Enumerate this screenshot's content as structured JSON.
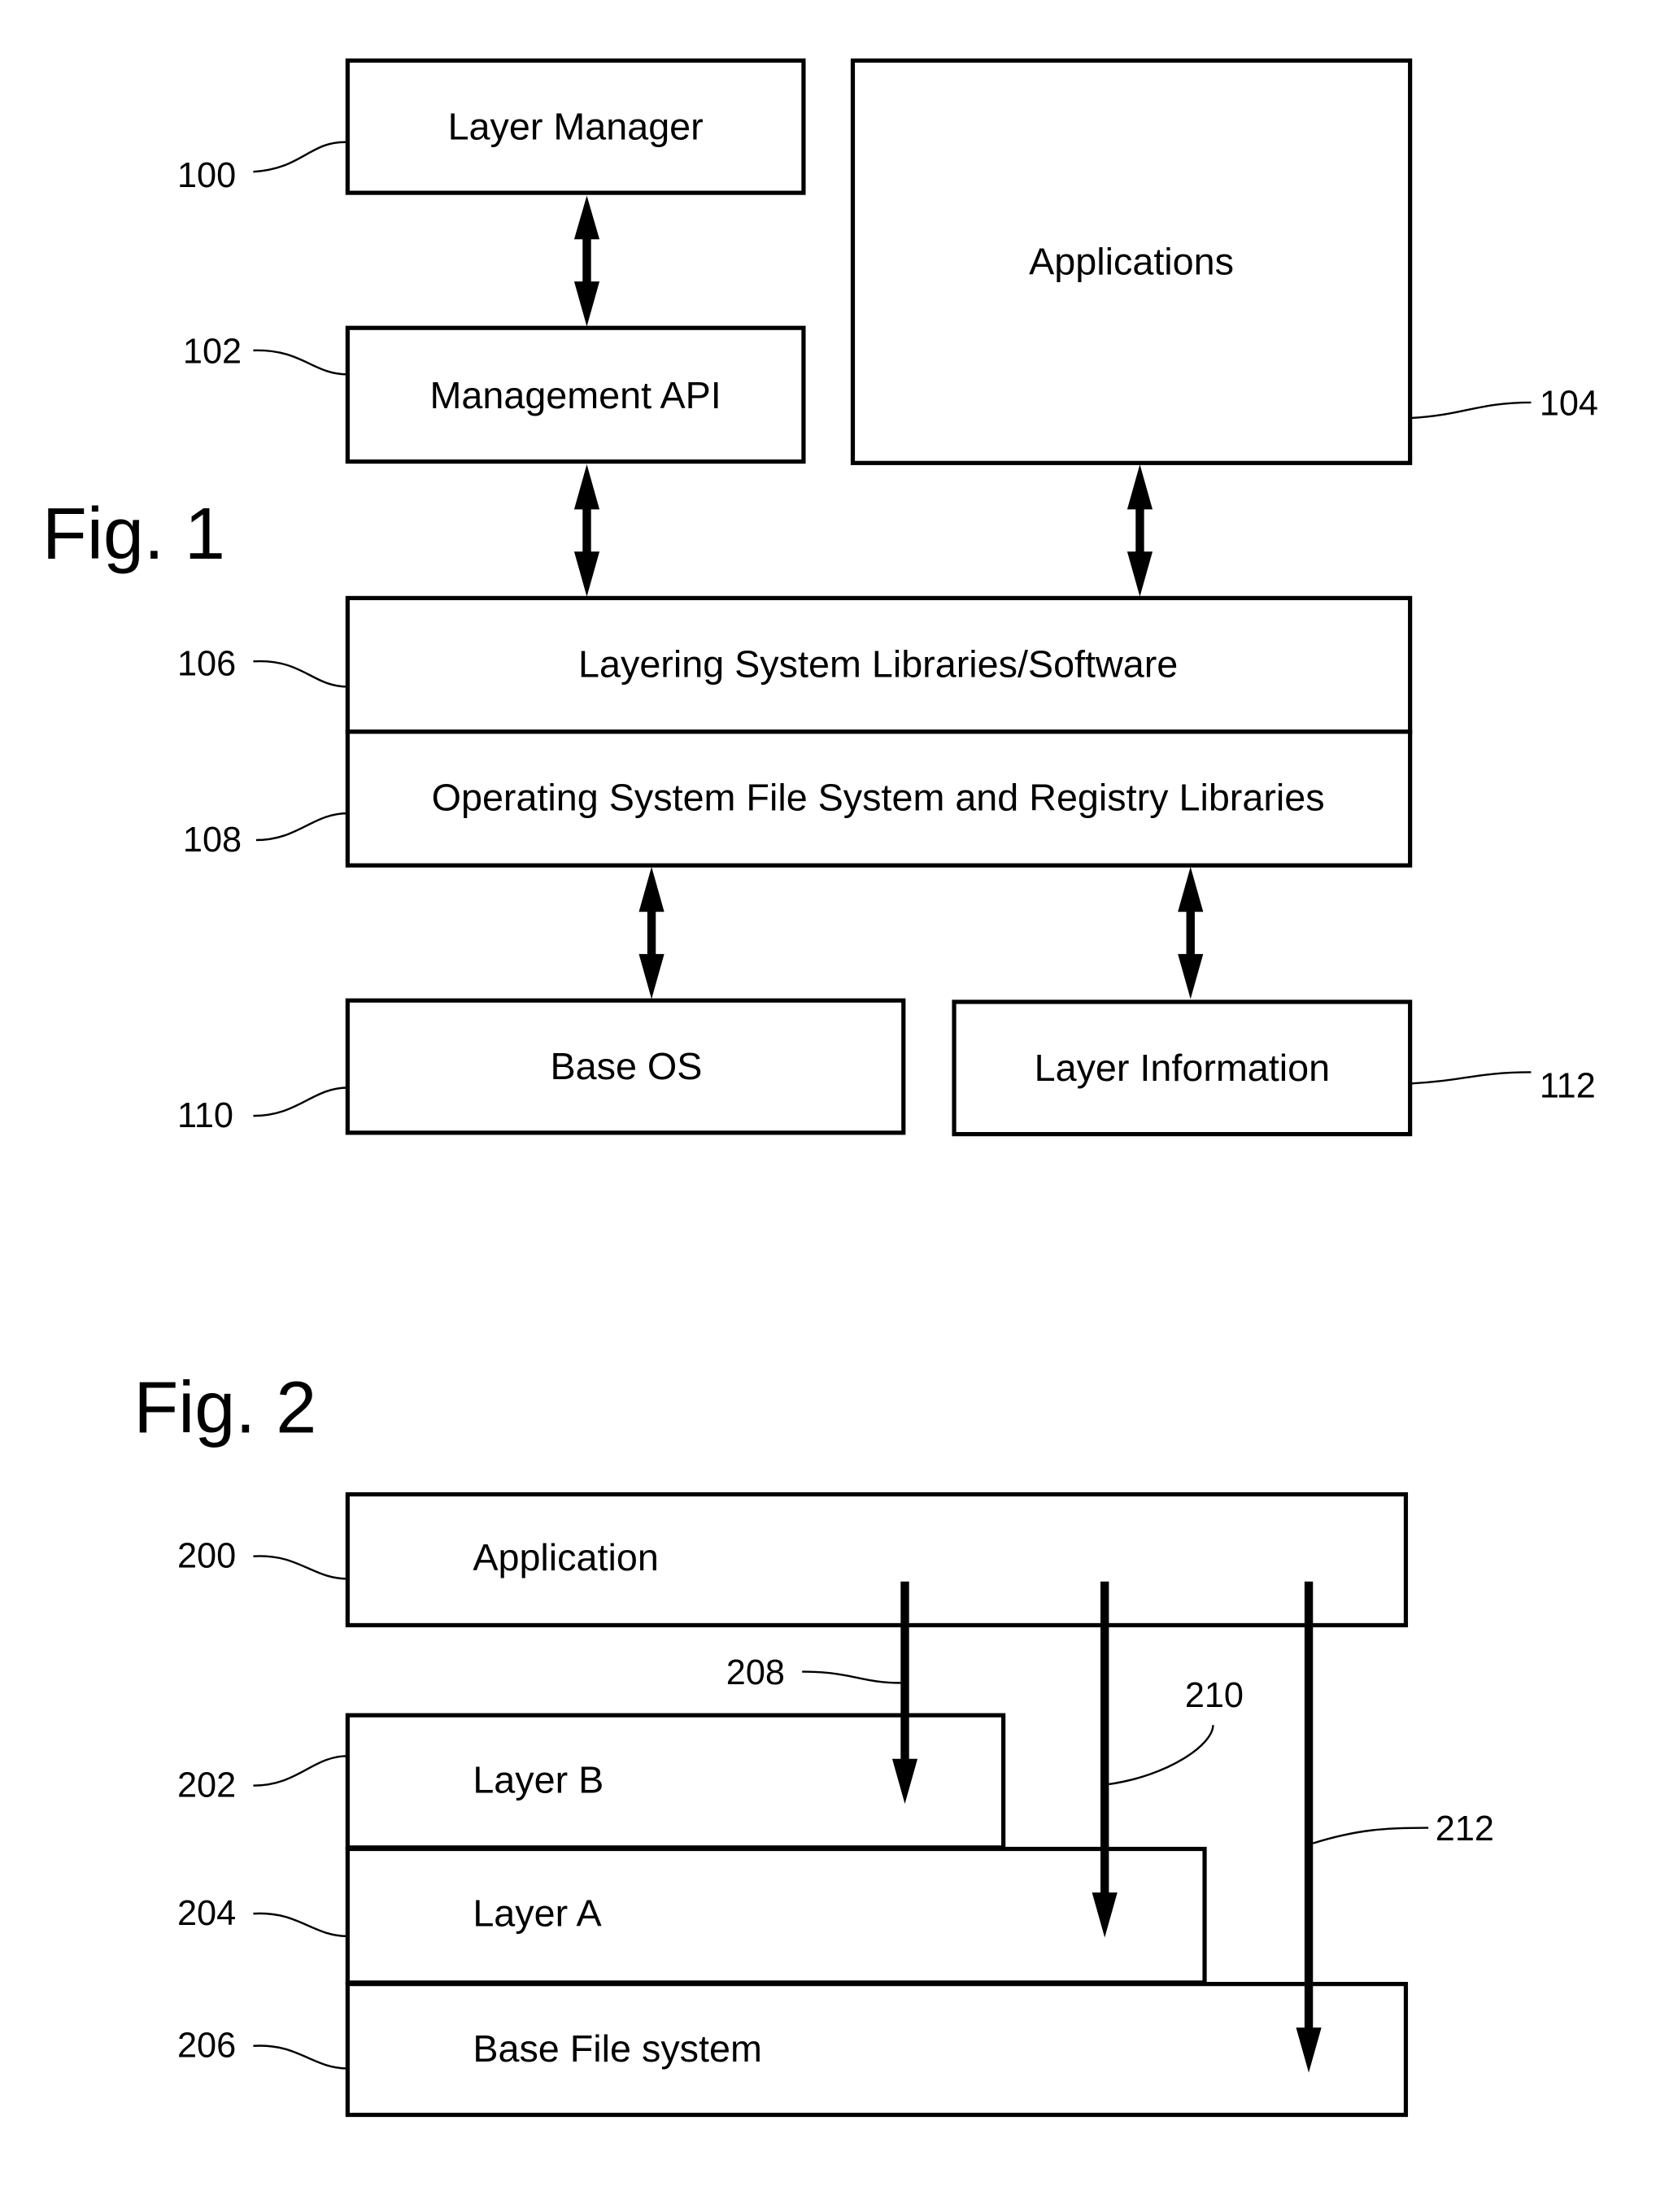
{
  "figure1": {
    "title": "Fig. 1",
    "boxes": {
      "layer_manager": {
        "label": "Layer Manager",
        "ref": "100"
      },
      "management_api": {
        "label": "Management API",
        "ref": "102"
      },
      "applications": {
        "label": "Applications",
        "ref": "104"
      },
      "layering_system": {
        "label": "Layering System Libraries/Software",
        "ref": "106"
      },
      "os_libraries": {
        "label": "Operating System File System and Registry Libraries",
        "ref": "108"
      },
      "base_os": {
        "label": "Base OS",
        "ref": "110"
      },
      "layer_information": {
        "label": "Layer Information",
        "ref": "112"
      }
    },
    "connections": [
      {
        "from": "layer_manager",
        "to": "management_api",
        "type": "bidirectional"
      },
      {
        "from": "management_api",
        "to": "layering_system",
        "type": "bidirectional"
      },
      {
        "from": "applications",
        "to": "layering_system",
        "type": "bidirectional"
      },
      {
        "from": "os_libraries",
        "to": "base_os",
        "type": "bidirectional"
      },
      {
        "from": "os_libraries",
        "to": "layer_information",
        "type": "bidirectional"
      }
    ]
  },
  "figure2": {
    "title": "Fig. 2",
    "boxes": {
      "application": {
        "label": "Application",
        "ref": "200"
      },
      "layer_b": {
        "label": "Layer B",
        "ref": "202"
      },
      "layer_a": {
        "label": "Layer A",
        "ref": "204"
      },
      "base_fs": {
        "label": "Base File system",
        "ref": "206"
      }
    },
    "arrows": [
      {
        "ref": "208",
        "from": "application",
        "to": "layer_b"
      },
      {
        "ref": "210",
        "from": "application",
        "to": "layer_a"
      },
      {
        "ref": "212",
        "from": "application",
        "to": "base_fs"
      }
    ]
  }
}
